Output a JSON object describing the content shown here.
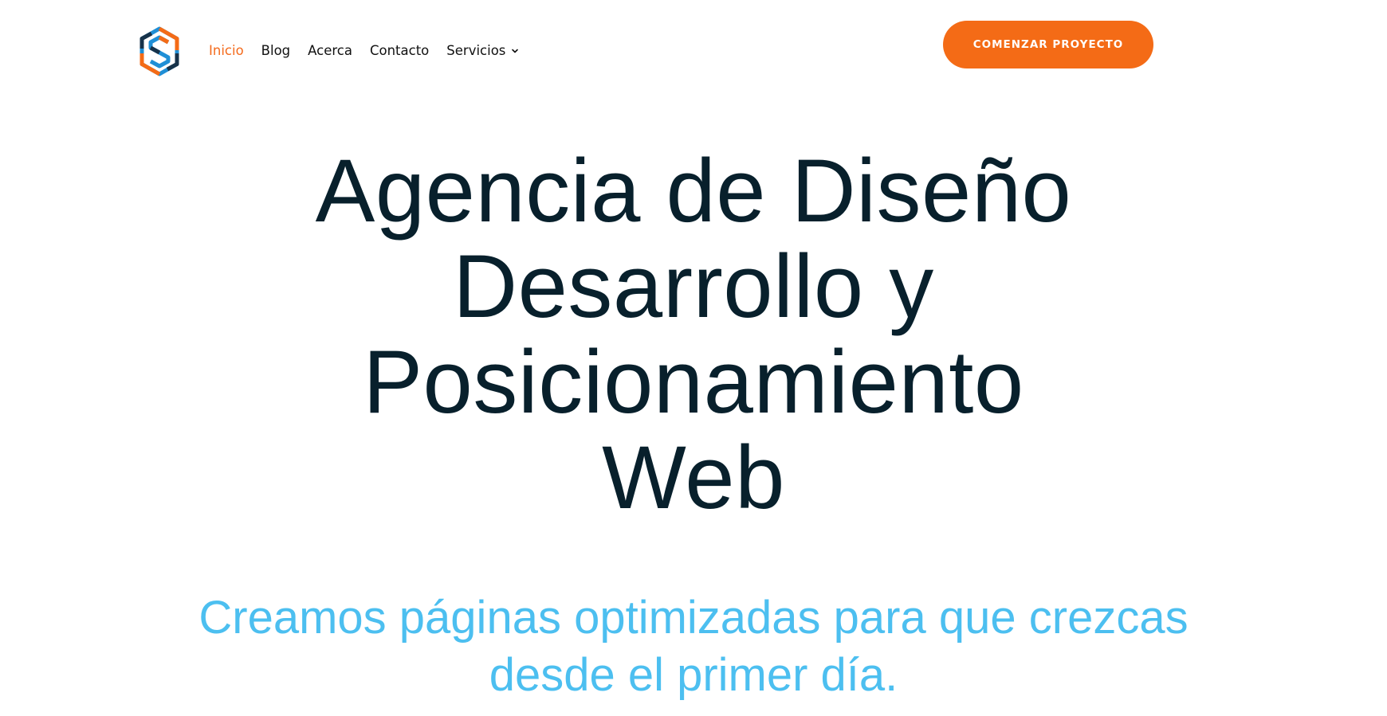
{
  "brand": {
    "logo_icon": "hexagon-s-logo-icon",
    "colors": {
      "orange": "#f46b16",
      "blue": "#1f8fd6",
      "navy": "#16324a",
      "subtitle": "#4cbff0",
      "title": "#08202c"
    }
  },
  "nav": {
    "items": [
      {
        "label": "Inicio",
        "active": true
      },
      {
        "label": "Blog"
      },
      {
        "label": "Acerca"
      },
      {
        "label": "Contacto"
      },
      {
        "label": "Servicios",
        "icon": "chevron-down-icon"
      }
    ]
  },
  "header": {
    "cta_label": "COMENZAR PROYECTO"
  },
  "hero": {
    "title_lines": [
      "Agencia de Diseño",
      "Desarrollo y",
      "Posicionamiento",
      "Web"
    ],
    "subtitle_lines": [
      "Creamos páginas optimizadas para que crezcas",
      "desde el primer día."
    ]
  }
}
